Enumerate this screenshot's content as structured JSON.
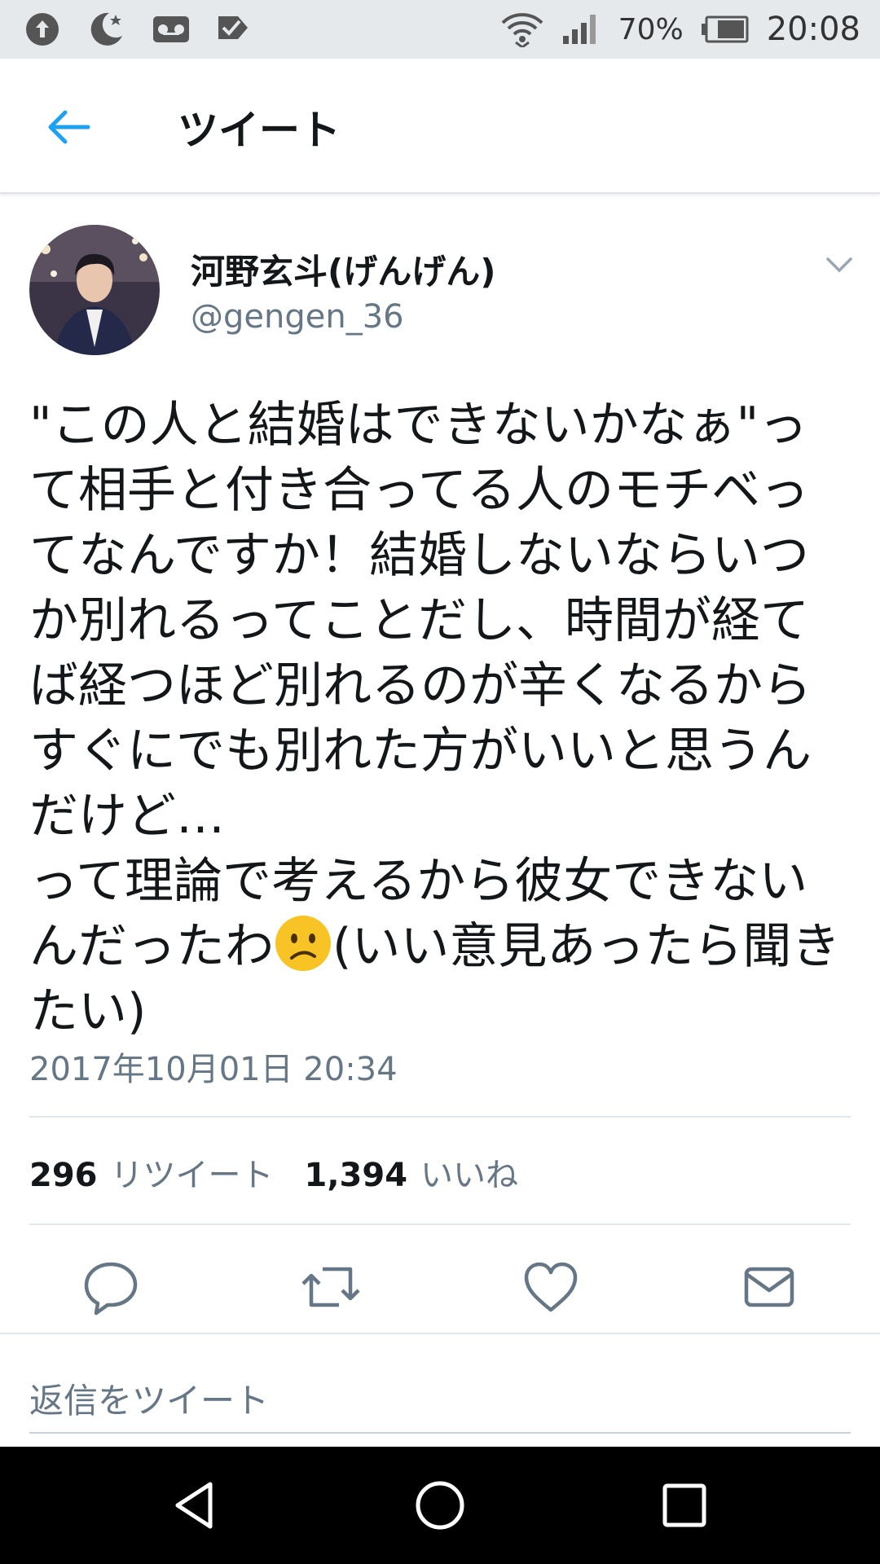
{
  "status_bar": {
    "battery": "70%",
    "time": "20:08",
    "left_icons": [
      "upload-icon",
      "moon-icon",
      "voicemail-icon",
      "check-icon"
    ],
    "right_icons": [
      "wifi-icon",
      "signal-icon",
      "battery-icon"
    ]
  },
  "header": {
    "title": "ツイート",
    "back_icon": "arrow-left-icon"
  },
  "tweet": {
    "author_name": "河野玄斗(げんげん)",
    "author_handle": "@gengen_36",
    "text_part1": "\"この人と結婚はできないかなぁ\"って相手と付き合ってる人のモチベってなんですか！結婚しないならいつか別れるってことだし、時間が経てば経つほど別れるのが辛くなるからすぐにでも別れた方がいいと思うんだけど…\nって理論で考えるから彼女できないんだったわ",
    "emoji": "confused-face-emoji",
    "text_part2": "(いい意見あったら聞きたい)",
    "timestamp": "2017年10月01日 20:34",
    "retweet_count": "296",
    "retweet_label": "リツイート",
    "like_count": "1,394",
    "like_label": "いいね"
  },
  "actions": [
    "reply-icon",
    "retweet-icon",
    "heart-icon",
    "mail-icon"
  ],
  "reply": {
    "placeholder": "返信をツイート"
  },
  "nav_bar": [
    "back-triangle-icon",
    "home-circle-icon",
    "recents-square-icon"
  ],
  "colors": {
    "accent": "#1da1f2",
    "secondary_text": "#657786",
    "primary_text": "#14171a",
    "status_bar_bg": "#e6e9ec",
    "nav_bar_bg": "#000000"
  }
}
